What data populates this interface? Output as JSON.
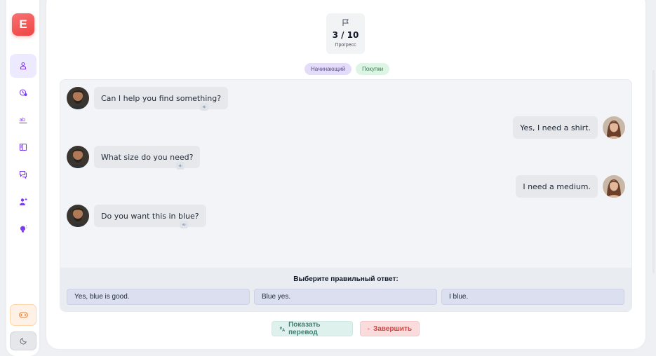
{
  "sidebar": {
    "logo_letter": "E",
    "items": [
      {
        "icon": "person-board-icon"
      },
      {
        "icon": "clock-location-icon"
      },
      {
        "icon": "ab-text-icon"
      },
      {
        "icon": "book-icon"
      },
      {
        "icon": "chat-icon"
      },
      {
        "icon": "user-add-icon"
      },
      {
        "icon": "bulb-icon"
      }
    ],
    "game_icon": "gamepad-icon",
    "theme_icon": "moon-icon"
  },
  "progress": {
    "count": "3 / 10",
    "label": "Прогресс"
  },
  "tags": {
    "level": "Начинающий",
    "topic": "Покупки"
  },
  "messages": [
    {
      "speaker": "bot",
      "text": "Can I help you find something?"
    },
    {
      "speaker": "user",
      "text": "Yes, I need a shirt."
    },
    {
      "speaker": "bot",
      "text": "What size do you need?"
    },
    {
      "speaker": "user",
      "text": "I need a medium."
    },
    {
      "speaker": "bot",
      "text": "Do you want this in blue?"
    }
  ],
  "answers": {
    "prompt": "Выберите правильный ответ:",
    "options": [
      "Yes, blue is good.",
      "Blue yes.",
      "I blue."
    ]
  },
  "actions": {
    "translate_label": "Показать перевод",
    "finish_label": "Завершить"
  },
  "colors": {
    "accent": "#8b5cf6",
    "logo": "#ef4444",
    "finish": "#d14343",
    "translate": "#3f7f74"
  }
}
